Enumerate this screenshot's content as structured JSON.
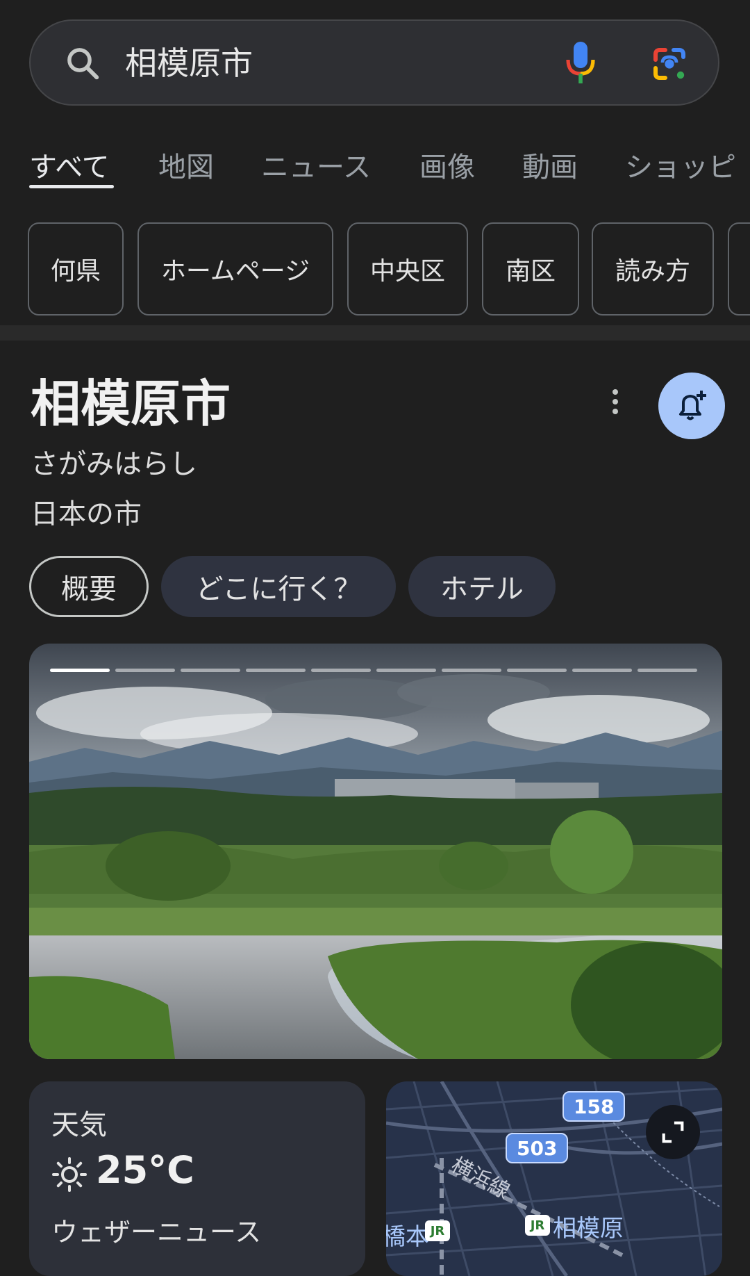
{
  "search": {
    "query": "相模原市",
    "icon": "search-icon",
    "mic_icon": "microphone-icon",
    "lens_icon": "google-lens-icon"
  },
  "tabs": [
    {
      "label": "すべて",
      "active": true
    },
    {
      "label": "地図",
      "active": false
    },
    {
      "label": "ニュース",
      "active": false
    },
    {
      "label": "画像",
      "active": false
    },
    {
      "label": "動画",
      "active": false
    },
    {
      "label": "ショッピ",
      "active": false
    }
  ],
  "chips": [
    "何県",
    "ホームページ",
    "中央区",
    "南区",
    "読み方"
  ],
  "knowledge_panel": {
    "title": "相模原市",
    "reading": "さがみはらし",
    "description": "日本の市",
    "pills": [
      {
        "label": "概要",
        "active": true
      },
      {
        "label": "どこに行く？",
        "active": false
      },
      {
        "label": "ホテル",
        "active": false
      }
    ],
    "image": {
      "description_icon": "landscape-photo",
      "slides_total": 10,
      "slide_current": 1
    }
  },
  "weather": {
    "title": "天気",
    "temperature": "25°C",
    "source": "ウェザーニュース",
    "icon": "sun-icon"
  },
  "map": {
    "route_badges": [
      "158",
      "503"
    ],
    "line_label": "横浜線",
    "station_label": "相模原",
    "station_label_left": "橋本",
    "jr_label": "JR"
  },
  "colors": {
    "background": "#1f1f1f",
    "accent": "#a8c7fa",
    "chip_border": "#5f6368"
  }
}
